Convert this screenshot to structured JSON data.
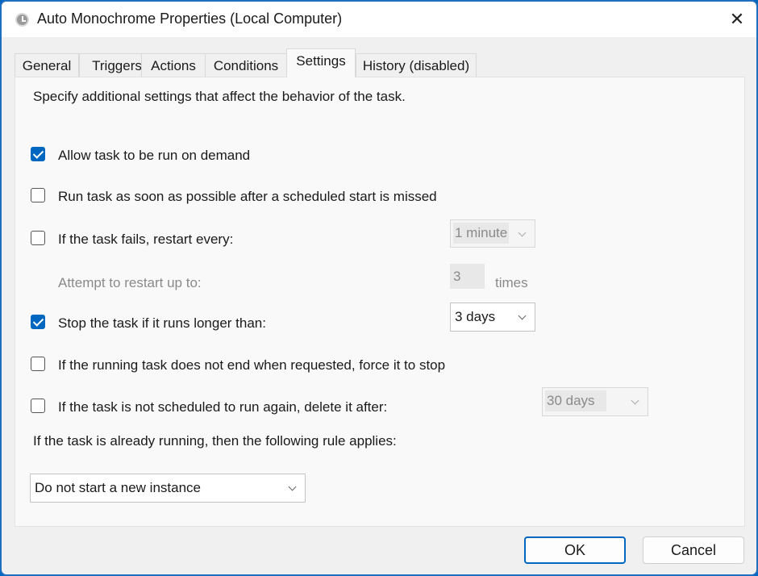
{
  "window": {
    "title": "Auto Monochrome Properties (Local Computer)",
    "icon": "clock-icon",
    "close_icon": "close-icon",
    "accent_color": "#0067c0"
  },
  "tabs": [
    {
      "label": "General"
    },
    {
      "label": "Triggers"
    },
    {
      "label": "Actions"
    },
    {
      "label": "Conditions"
    },
    {
      "label": "Settings",
      "active": true
    },
    {
      "label": "History (disabled)"
    }
  ],
  "settings": {
    "description": "Specify additional settings that affect the behavior of the task.",
    "allow_on_demand": {
      "label": "Allow task to be run on demand",
      "checked": true
    },
    "run_missed": {
      "label": "Run task as soon as possible after a scheduled start is missed",
      "checked": false
    },
    "restart": {
      "label": "If the task fails, restart every:",
      "checked": false,
      "interval": "1 minute",
      "attempt_label": "Attempt to restart up to:",
      "attempt_count": "3",
      "times_label": "times"
    },
    "stop_long": {
      "label": "Stop the task if it runs longer than:",
      "checked": true,
      "value": "3 days"
    },
    "force_stop": {
      "label": "If the running task does not end when requested, force it to stop",
      "checked": false
    },
    "delete_after": {
      "label": "If the task is not scheduled to run again, delete it after:",
      "checked": false,
      "value": "30 days"
    },
    "running_rule_label": "If the task is already running, then the following rule applies:",
    "running_rule_value": "Do not start a new instance"
  },
  "footer": {
    "ok_label": "OK",
    "cancel_label": "Cancel"
  }
}
